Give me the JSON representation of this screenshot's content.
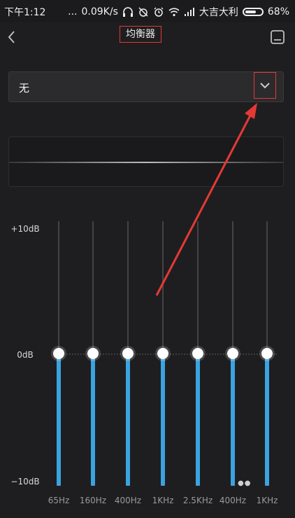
{
  "status_bar": {
    "time": "下午1:12",
    "dots": "...",
    "speed": "0.09K/s",
    "carrier": "大吉大利",
    "battery": "68%",
    "battery_level": 0.68,
    "icons": [
      "headphones-icon",
      "alarm-off-icon",
      "alarm-icon",
      "wifi-icon",
      "signal-icon",
      "battery-icon"
    ]
  },
  "header": {
    "title": "均衡器",
    "back_icon": "back-arrow-icon",
    "save_icon": "save-icon"
  },
  "preset": {
    "value": "无",
    "arrow_icon": "chevron-down-icon"
  },
  "eq": {
    "labels": {
      "max": "+10dB",
      "zero": "0dB",
      "min": "−10dB"
    },
    "bands": [
      {
        "freq": "65Hz",
        "gain_db": 0
      },
      {
        "freq": "160Hz",
        "gain_db": 0
      },
      {
        "freq": "400Hz",
        "gain_db": 0
      },
      {
        "freq": "1KHz",
        "gain_db": 0
      },
      {
        "freq": "2.5KHz",
        "gain_db": 0
      },
      {
        "freq": "400Hz",
        "gain_db": 0
      },
      {
        "freq": "1KHz",
        "gain_db": 0
      }
    ],
    "range_db": [
      -10,
      10
    ],
    "fill_color": "#3aa3e0"
  },
  "annotation": {
    "highlight_color": "#e53935"
  }
}
